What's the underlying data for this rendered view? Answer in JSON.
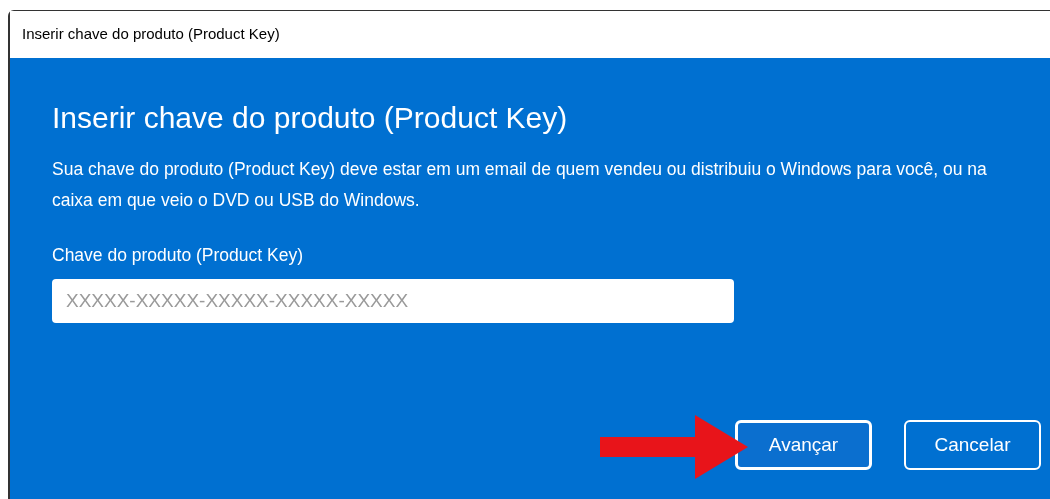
{
  "window": {
    "title": "Inserir chave do produto (Product Key)"
  },
  "heading": "Inserir chave do produto (Product Key)",
  "description": "Sua chave do produto (Product Key) deve estar em um email de quem vendeu ou distribuiu o Windows para você, ou na caixa em que veio o DVD ou USB do Windows.",
  "field": {
    "label": "Chave do produto (Product Key)",
    "placeholder": "XXXXX-XXXXX-XXXXX-XXXXX-XXXXX"
  },
  "buttons": [
    {
      "label": "Avançar",
      "highlighted": true
    },
    {
      "label": "Cancelar",
      "highlighted": false
    }
  ]
}
